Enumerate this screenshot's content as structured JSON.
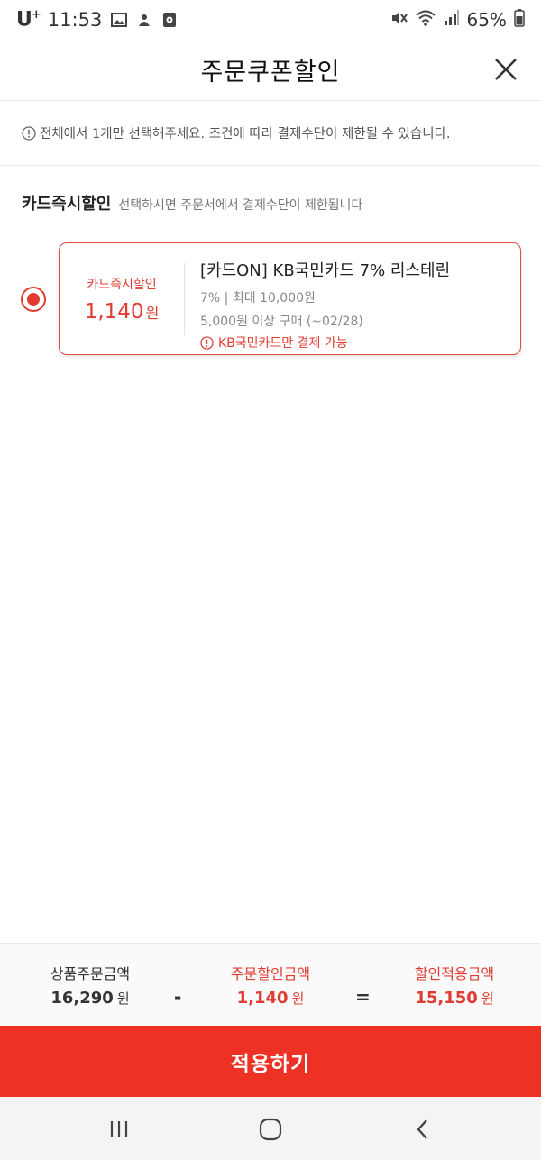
{
  "status_bar": {
    "carrier": "U",
    "carrier_sup": "+",
    "time": "11:53",
    "battery": "65%",
    "icons": [
      "gallery-icon",
      "app-icon",
      "media-icon",
      "mute-icon",
      "wifi-icon",
      "signal-icon",
      "battery-icon"
    ]
  },
  "header": {
    "title": "주문쿠폰할인",
    "close_icon": "close-icon"
  },
  "notice": {
    "text": "전체에서 1개만 선택해주세요. 조건에 따라 결제수단이 제한될 수 있습니다."
  },
  "section": {
    "title": "카드즉시할인",
    "description": "선택하시면 주문서에서 결제수단이 제한됩니다"
  },
  "coupon": {
    "selected": true,
    "type_label": "카드즉시할인",
    "amount": "1,140",
    "amount_unit": "원",
    "name": "[카드ON] KB국민카드 7% 리스테린",
    "rate": "7% | 최대 10,000원",
    "condition": "5,000원 이상 구매 (~02/28)",
    "warning": "KB국민카드만 결제 가능"
  },
  "summary": {
    "product_label": "상품주문금액",
    "product_value": "16,290",
    "minus": "-",
    "discount_label": "주문할인금액",
    "discount_value": "1,140",
    "equals": "=",
    "final_label": "할인적용금액",
    "final_value": "15,150",
    "unit": "원"
  },
  "apply_button": {
    "label": "적용하기"
  },
  "colors": {
    "accent": "#e03c31",
    "button": "#ed3124"
  }
}
